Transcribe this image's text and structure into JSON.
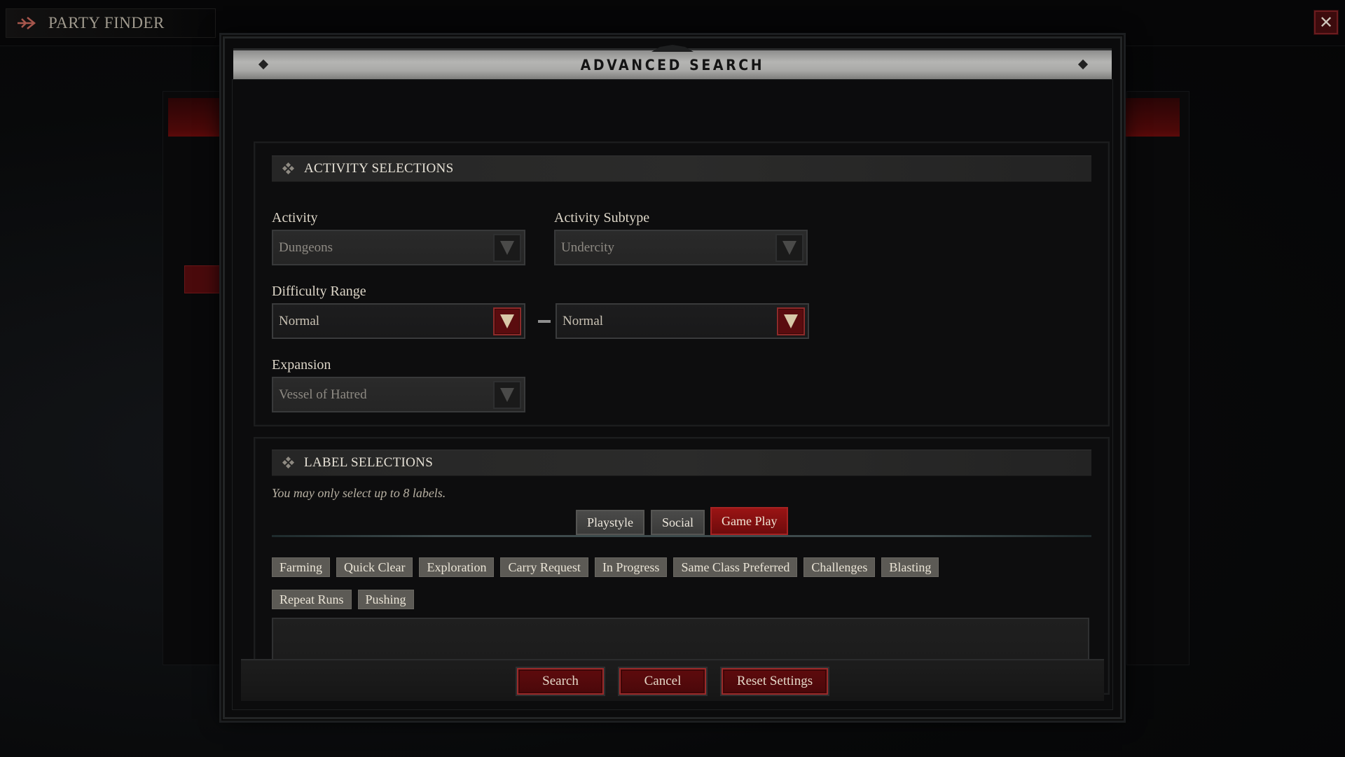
{
  "topbar": {
    "title": "PARTY FINDER",
    "icon": "party-arrow-icon",
    "close_icon": "✕"
  },
  "modal": {
    "title": "ADVANCED SEARCH",
    "activity_section": {
      "header": "ACTIVITY SELECTIONS",
      "activity": {
        "label": "Activity",
        "value": "Dungeons",
        "enabled": false
      },
      "activity_subtype": {
        "label": "Activity Subtype",
        "value": "Undercity",
        "enabled": false
      },
      "difficulty_range": {
        "label": "Difficulty Range",
        "min": {
          "value": "Normal",
          "enabled": true
        },
        "max": {
          "value": "Normal",
          "enabled": true
        }
      },
      "expansion": {
        "label": "Expansion",
        "value": "Vessel of Hatred",
        "enabled": false
      }
    },
    "label_section": {
      "header": "LABEL SELECTIONS",
      "hint": "You may only select up to 8 labels.",
      "tabs": [
        {
          "label": "Playstyle",
          "active": false
        },
        {
          "label": "Social",
          "active": false
        },
        {
          "label": "Game Play",
          "active": true
        }
      ],
      "labels": [
        "Farming",
        "Quick Clear",
        "Exploration",
        "Carry Request",
        "In Progress",
        "Same Class Preferred",
        "Challenges",
        "Blasting",
        "Repeat Runs",
        "Pushing"
      ],
      "selected_labels": []
    },
    "footer": {
      "search": "Search",
      "cancel": "Cancel",
      "reset": "Reset Settings"
    }
  },
  "colors": {
    "accent_red": "#8e1414",
    "chip_bg": "#5c5a55",
    "title_bar": "#b0b0ae"
  }
}
